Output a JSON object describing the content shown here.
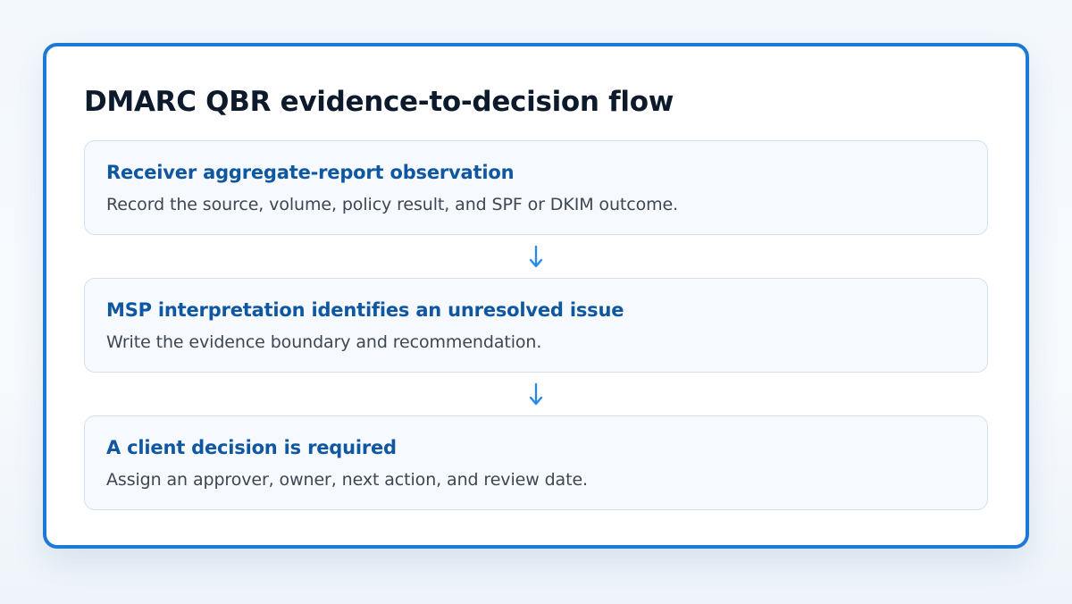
{
  "title": "DMARC QBR evidence-to-decision flow",
  "steps": [
    {
      "title": "Receiver aggregate-report observation",
      "description": "Record the source, volume, policy result, and SPF or DKIM outcome."
    },
    {
      "title": "MSP interpretation identifies an unresolved issue",
      "description": "Write the evidence boundary and recommendation."
    },
    {
      "title": "A client decision is required",
      "description": "Assign an approver, owner, next action, and review date."
    }
  ],
  "connector_icon": "arrow-down-icon",
  "colors": {
    "accent": "#1d78d6",
    "step_title": "#0f57a0",
    "arrow": "#2a8ae6"
  }
}
